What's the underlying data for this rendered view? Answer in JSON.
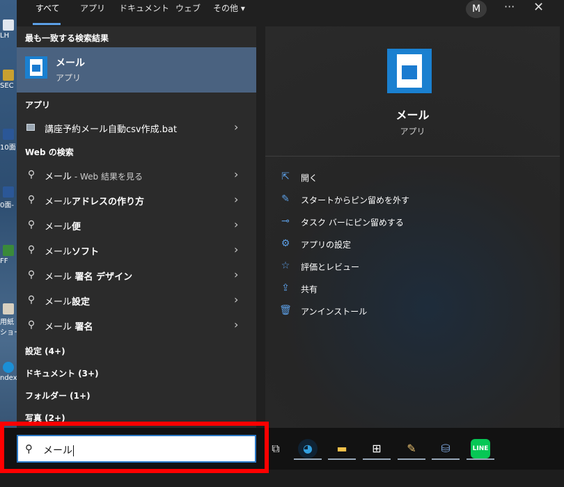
{
  "tabs": [
    "すべて",
    "アプリ",
    "ドキュメント",
    "ウェブ",
    "その他 ▾"
  ],
  "header": {
    "avatar": "M",
    "more": "···",
    "close": "✕"
  },
  "desktop_icons": [
    "LH",
    "SEC",
    "10面",
    "0面-",
    "FF",
    "用紙",
    "ショー",
    "ndex"
  ],
  "left": {
    "best_match_heading": "最も一致する検索結果",
    "best_match": {
      "title": "メール",
      "subtitle": "アプリ"
    },
    "apps_heading": "アプリ",
    "apps": [
      {
        "label": "講座予約メール自動csv作成.bat"
      }
    ],
    "web_heading": "Web の検索",
    "web_results": [
      {
        "main": "メール",
        "extra": " - Web 結果を見る"
      },
      {
        "main": "メール",
        "extra": "アドレスの作り方"
      },
      {
        "main": "メール",
        "extra": "便"
      },
      {
        "main": "メール",
        "extra": "ソフト"
      },
      {
        "main": "メール",
        "extra": " 署名 デザイン"
      },
      {
        "main": "メール",
        "extra": "設定"
      },
      {
        "main": "メール",
        "extra": " 署名"
      }
    ],
    "categories": [
      "設定 (4+)",
      "ドキュメント (3+)",
      "フォルダー (1+)",
      "写真 (2+)"
    ]
  },
  "right": {
    "title": "メール",
    "subtitle": "アプリ",
    "actions": [
      {
        "icon": "open-icon",
        "label": "開く"
      },
      {
        "icon": "unpin-icon",
        "label": "スタートからピン留めを外す"
      },
      {
        "icon": "pin-icon",
        "label": "タスク バーにピン留めする"
      },
      {
        "icon": "gear-icon",
        "label": "アプリの設定"
      },
      {
        "icon": "star-icon",
        "label": "評価とレビュー"
      },
      {
        "icon": "share-icon",
        "label": "共有"
      },
      {
        "icon": "trash-icon",
        "label": "アンインストール"
      }
    ]
  },
  "search": {
    "value": "メール"
  },
  "taskbar": [
    "task-view-icon",
    "edge-icon",
    "file-explorer-icon",
    "store-icon",
    "app-icon",
    "network-app-icon",
    "line-icon"
  ],
  "colors": {
    "accent": "#5c9fe6",
    "highlight": "#ff0000",
    "selected": "#4a6280"
  }
}
